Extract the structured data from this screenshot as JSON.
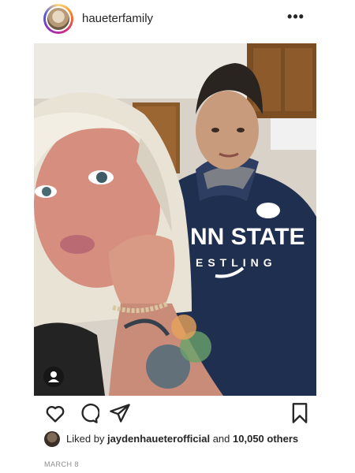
{
  "post": {
    "username": "haueterfamily",
    "more_icon": "more-horizontal-icon",
    "photo_alt": "",
    "shirt_text_line1": "NN STATE",
    "shirt_text_line2": "ESTLING",
    "likes": {
      "prefix": "Liked by ",
      "user": "jaydenhaueterofficial",
      "middle": " and ",
      "count": "10,050 others"
    },
    "date": "MARCH 8"
  },
  "icons": {
    "like": "heart-outline-icon",
    "comment": "comment-bubble-icon",
    "share": "paper-plane-icon",
    "save": "bookmark-outline-icon",
    "tag": "user-tag-icon"
  },
  "colors": {
    "text": "#262626",
    "muted": "#8e8e8e",
    "hoodie": "#1f2f4f"
  }
}
